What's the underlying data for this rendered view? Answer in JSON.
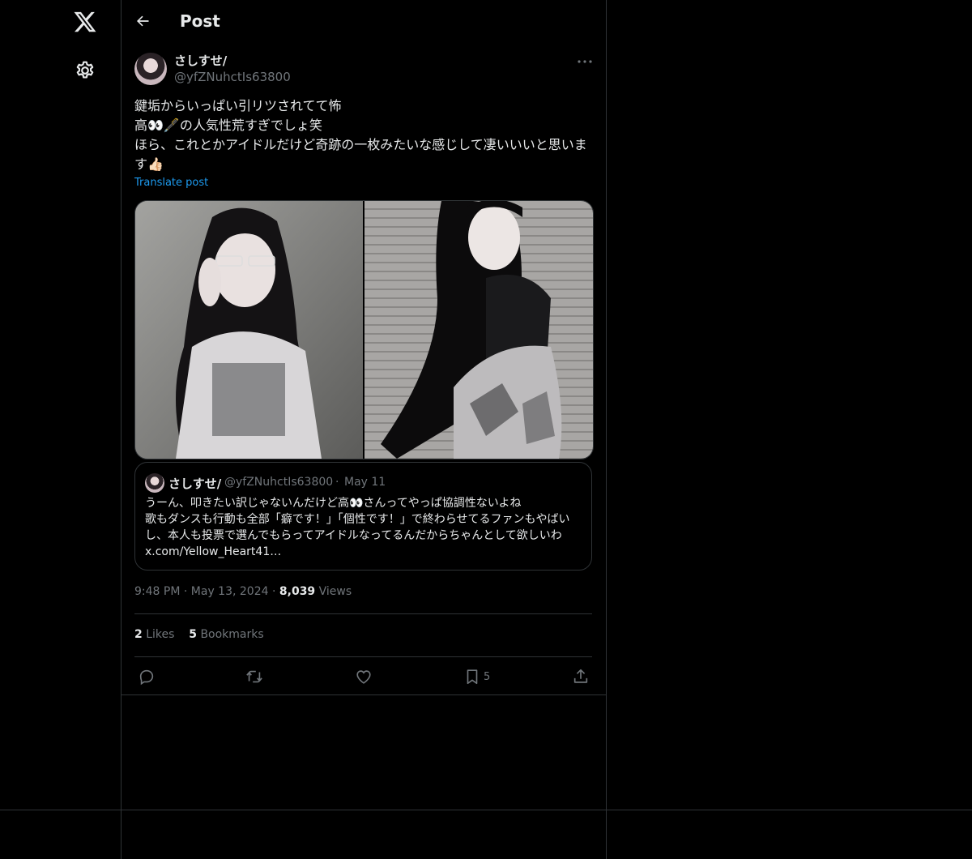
{
  "header": {
    "title": "Post"
  },
  "post": {
    "author_name": "さしすせ/",
    "author_handle": "@yfZNuhctIs63800",
    "text": "鍵垢からいっぱい引リツされてて怖\n高👀🖋️の人気性荒すぎでしょ笑\nほら、これとかアイドルだけど奇跡の一枚みたいな感じして凄いいいと思います👍🏻",
    "translate_label": "Translate post",
    "time": "9:48 PM",
    "date": "May 13, 2024",
    "views_count": "8,039",
    "views_label": "Views",
    "likes_count": "2",
    "likes_label": "Likes",
    "bookmarks_count": "5",
    "bookmarks_label": "Bookmarks",
    "bookmark_action_count": "5"
  },
  "quote": {
    "author_name": "さしすせ/",
    "author_handle": "@yfZNuhctIs63800",
    "separator": "·",
    "date": "May 11",
    "text": "うーん、叩きたい訳じゃないんだけど高👀さんってやっぱ協調性ないよね\n歌もダンスも行動も全部「癖です！」「個性です！」で終わらせてるファンもやばいし、本人も投票で選んでもらってアイドルなってるんだからちゃんとして欲しいわ x.com/Yellow_Heart41…"
  },
  "separators": {
    "dot": "·"
  },
  "icons": [
    "x-logo-icon",
    "gear-icon",
    "back-arrow-icon",
    "more-icon",
    "reply-icon",
    "repost-icon",
    "like-icon",
    "bookmark-icon",
    "share-icon"
  ],
  "colors": {
    "background": "#000000",
    "text": "#e7e9ea",
    "secondary": "#71767b",
    "link": "#1d9bf0",
    "border": "#2f3336"
  }
}
